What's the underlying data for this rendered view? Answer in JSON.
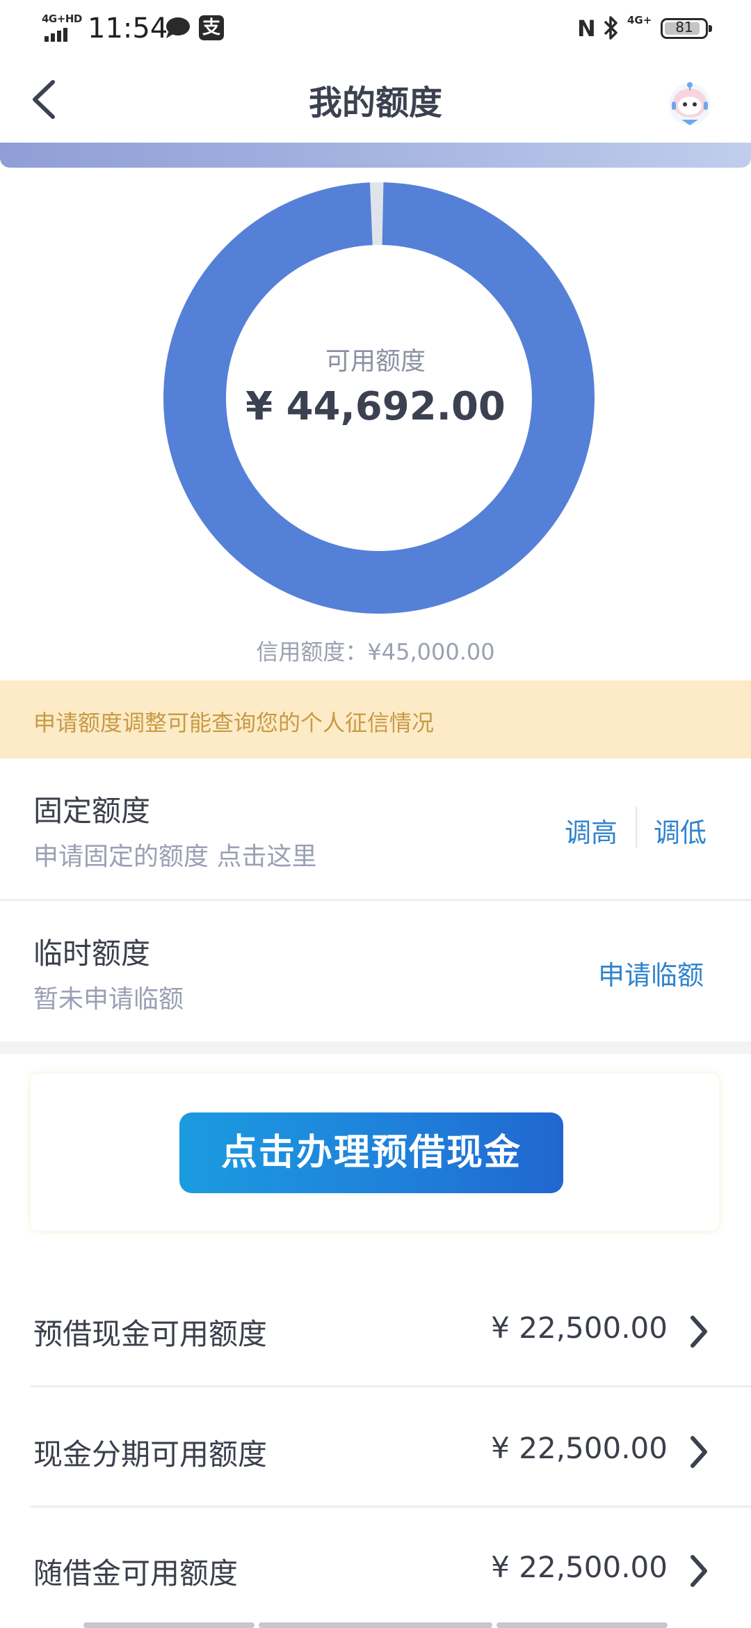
{
  "status_bar": {
    "network_tag": "4G+HD",
    "time": "11:54",
    "pay_glyph": "支",
    "nfc": "N",
    "network_tag_right": "4G+",
    "battery": "81",
    "icons": [
      "signal-icon",
      "chat-bubble-icon",
      "alipay-icon",
      "nfc-icon",
      "bluetooth-icon",
      "battery-icon"
    ]
  },
  "header": {
    "title": "我的额度",
    "back_icon": "chevron-left-icon",
    "avatar_icon": "robot-assistant-icon"
  },
  "summary": {
    "available_label": "可用额度",
    "available_value": "¥ 44,692.00",
    "credit_limit_text": "信用额度：¥45,000.00",
    "donut": {
      "available": 44692.0,
      "total": 45000.0,
      "color": "#5580d8",
      "remainder_color": "#dfe3ea"
    }
  },
  "notice": {
    "text": "申请额度调整可能查询您的个人征信情况",
    "background": "#fcebc6",
    "color": "#c89a45"
  },
  "fixed_limit": {
    "title": "固定额度",
    "subtitle": "申请固定的额度 点击这里",
    "raise_label": "调高",
    "lower_label": "调低"
  },
  "temp_limit": {
    "title": "临时额度",
    "subtitle": "暂未申请临额",
    "apply_label": "申请临额"
  },
  "banner": {
    "button_label": "点击办理预借现金"
  },
  "amounts": [
    {
      "label": "预借现金可用额度",
      "value": "¥ 22,500.00"
    },
    {
      "label": "现金分期可用额度",
      "value": "¥ 22,500.00"
    },
    {
      "label": "随借金可用额度",
      "value": "¥ 22,500.00"
    }
  ],
  "colors": {
    "accent_link": "#2f84cb",
    "donut_fill": "#5580d8"
  }
}
